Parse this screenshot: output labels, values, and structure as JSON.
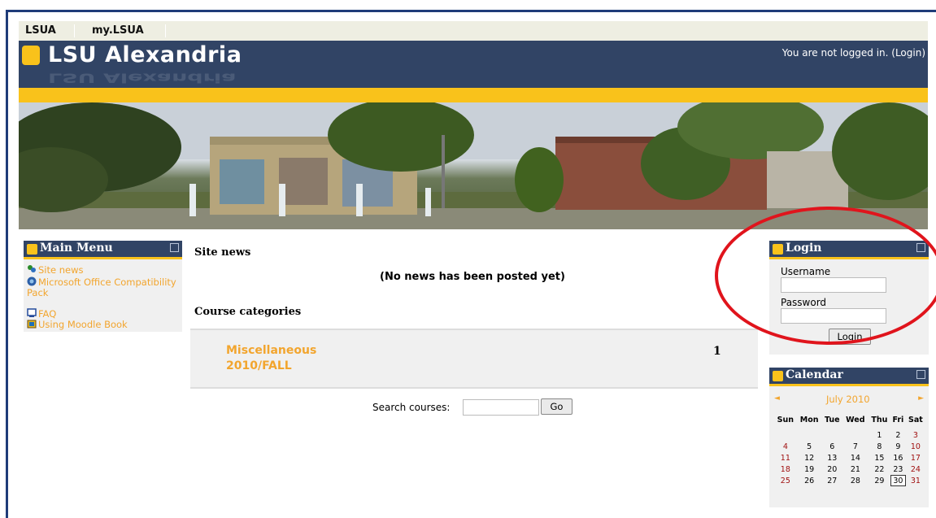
{
  "nav": {
    "link1": "LSUA",
    "link2": "my.LSUA"
  },
  "header": {
    "site_name": "LSU Alexandria",
    "login_status": "You are not logged in. (Login)"
  },
  "main_menu": {
    "title": "Main Menu",
    "items": [
      "Site news",
      "Microsoft Office Compatibility Pack",
      "FAQ",
      "Using Moodle Book"
    ]
  },
  "site_news": {
    "title": "Site news",
    "empty_message": "(No news has been posted yet)"
  },
  "course_categories": {
    "title": "Course categories",
    "category_name_line1": "Miscellaneous",
    "category_name_line2": "2010/FALL",
    "course_count": "1"
  },
  "search": {
    "label": "Search courses:",
    "value": "",
    "button": "Go"
  },
  "login": {
    "title": "Login",
    "username_label": "Username",
    "password_label": "Password",
    "username_value": "",
    "password_value": "",
    "button": "Login"
  },
  "calendar": {
    "title": "Calendar",
    "prev": "◄",
    "next": "►",
    "month": "July 2010",
    "weekdays": [
      "Sun",
      "Mon",
      "Tue",
      "Wed",
      "Thu",
      "Fri",
      "Sat"
    ],
    "weeks": [
      [
        "",
        "",
        "",
        "",
        "1",
        "2",
        "3"
      ],
      [
        "4",
        "5",
        "6",
        "7",
        "8",
        "9",
        "10"
      ],
      [
        "11",
        "12",
        "13",
        "14",
        "15",
        "16",
        "17"
      ],
      [
        "18",
        "19",
        "20",
        "21",
        "22",
        "23",
        "24"
      ],
      [
        "25",
        "26",
        "27",
        "28",
        "29",
        "30",
        "31"
      ]
    ],
    "today": "30",
    "weekend_color": "#a01010"
  },
  "colors": {
    "navy": "#314465",
    "gold": "#f9c21b",
    "link": "#f2a52e",
    "highlight_ring": "#e0141c"
  }
}
